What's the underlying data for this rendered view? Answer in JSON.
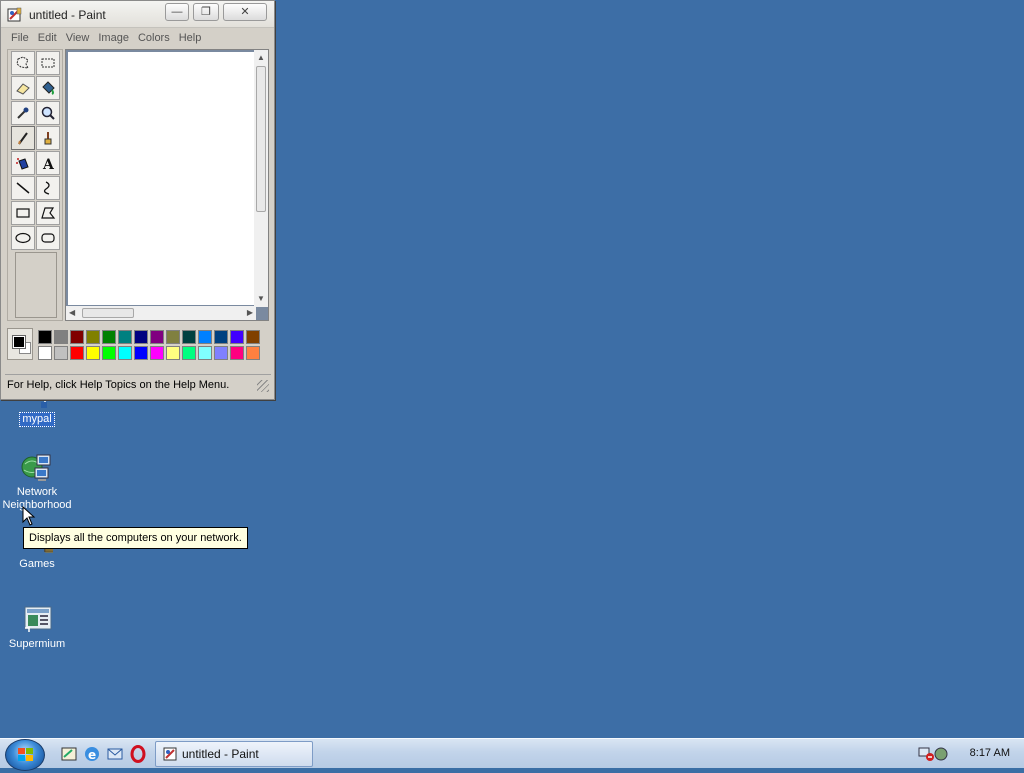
{
  "window": {
    "title": "untitled - Paint",
    "controls": {
      "minimize": "—",
      "maximize": "❐",
      "close": "✕"
    },
    "menu": [
      "File",
      "Edit",
      "View",
      "Image",
      "Colors",
      "Help"
    ],
    "status": "For Help, click Help Topics on the Help Menu.",
    "tools": [
      {
        "name": "free-form-select",
        "icon": "✂"
      },
      {
        "name": "select",
        "icon": "▭"
      },
      {
        "name": "eraser",
        "icon": "eraser"
      },
      {
        "name": "fill-with-color",
        "icon": "bucket"
      },
      {
        "name": "pick-color",
        "icon": "dropper"
      },
      {
        "name": "magnifier",
        "icon": "magnifier"
      },
      {
        "name": "pencil",
        "icon": "pencil"
      },
      {
        "name": "brush",
        "icon": "brush"
      },
      {
        "name": "airbrush",
        "icon": "airbrush"
      },
      {
        "name": "text",
        "icon": "A"
      },
      {
        "name": "line",
        "icon": "line"
      },
      {
        "name": "curve",
        "icon": "curve"
      },
      {
        "name": "rectangle",
        "icon": "rect"
      },
      {
        "name": "polygon",
        "icon": "polygon"
      },
      {
        "name": "ellipse",
        "icon": "ellipse"
      },
      {
        "name": "rounded-rectangle",
        "icon": "roundrect"
      }
    ],
    "active_tool": "pencil",
    "palette_top": [
      "#000000",
      "#808080",
      "#800000",
      "#808000",
      "#008000",
      "#008080",
      "#000080",
      "#800080",
      "#808040",
      "#004040",
      "#0080ff",
      "#004080",
      "#4000ff",
      "#804000"
    ],
    "palette_bottom": [
      "#ffffff",
      "#c0c0c0",
      "#ff0000",
      "#ffff00",
      "#00ff00",
      "#00ffff",
      "#0000ff",
      "#ff00ff",
      "#ffff80",
      "#00ff80",
      "#80ffff",
      "#8080ff",
      "#ff0080",
      "#ff8040"
    ]
  },
  "desktop": {
    "icons": [
      {
        "label": "mypal",
        "selected": true
      },
      {
        "label": "Network Neighborhood",
        "selected": false
      },
      {
        "label": "Games",
        "selected": false
      },
      {
        "label": "Supermium",
        "selected": false
      }
    ],
    "tooltip": "Displays all the computers on your network."
  },
  "taskbar": {
    "task_label": "untitled - Paint",
    "clock": "8:17 AM"
  },
  "colors": {
    "desktop": "#3d6ea6",
    "selection": "#316ac5"
  }
}
